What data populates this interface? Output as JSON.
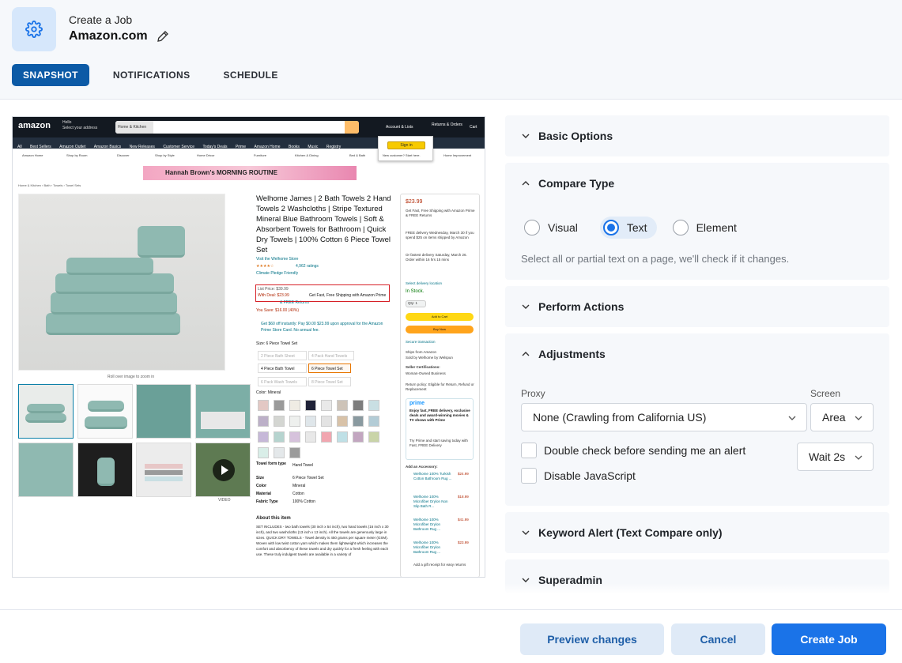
{
  "header": {
    "icon": "gear-icon",
    "subtitle": "Create a Job",
    "title": "Amazon.com",
    "edit_icon": "pencil-icon"
  },
  "tabs": [
    {
      "label": "SNAPSHOT",
      "active": true
    },
    {
      "label": "NOTIFICATIONS",
      "active": false
    },
    {
      "label": "SCHEDULE",
      "active": false
    }
  ],
  "preview": {
    "logo": "amazon",
    "address": "Select your address",
    "search_category": "Home & Kitchen",
    "account": "Account & Lists",
    "returns": "Returns & Orders",
    "cart": "Cart",
    "nav_items": [
      "All",
      "Best Sellers",
      "Amazon Outlet",
      "Amazon Basics",
      "New Releases",
      "Customer Service",
      "Today's Deals",
      "Prime",
      "Amazon Home",
      "Books",
      "Music",
      "Registry"
    ],
    "signin_button": "Sign in",
    "signin_text": "New customer? Start here.",
    "subnav": [
      "Amazon Home",
      "Shop by Room",
      "Discover",
      "Shop by Style",
      "Home Décor",
      "Furniture",
      "Kitchen & Dining",
      "Bed & Bath",
      "Home Improvement"
    ],
    "banner": "Hannah Brown's MORNING ROUTINE",
    "breadcrumb": "Home & Kitchen › Bath › Towels › Towel Sets",
    "roll_over": "Roll over image to zoom in",
    "product_title": "Welhome James | 2 Bath Towels 2 Hand Towels 2 Washcloths | Stripe Textured Mineral Blue Bathroom Towels | Soft & Absorbent Towels for Bathroom | Quick Dry Towels | 100% Cotton 6 Piece Towel Set",
    "store_link": "Visit the Welhome Store",
    "ratings": "4,962 ratings",
    "climate": "Climate Pledge Friendly",
    "list_price": "List Price: $39.99",
    "deal_price": "With Deal: $23.99",
    "free_shipping": "Get Fast, Free Shipping with Amazon Prime",
    "free_returns": "& FREE Returns",
    "you_save": "You Save: $16.00 (40%)",
    "instant_offer": "Get $60 off instantly: Pay $0.00 $23.99 upon approval for the Amazon Prime Store Card. No annual fee.",
    "size_label": "Size: 6 Piece Towel Set",
    "sizes": [
      "2 Piece Bath Sheet",
      "4 Pack Hand Towels",
      "4 Piece Bath Towel",
      "6 Piece Towel Set",
      "6 Pack Wash Towels",
      "8 Piece Towel Set"
    ],
    "color_label": "Color: Mineral",
    "details": [
      [
        "Towel form type",
        "Hand Towel"
      ],
      [
        "Size",
        "6 Piece Towel Set"
      ],
      [
        "Color",
        "Mineral"
      ],
      [
        "Material",
        "Cotton"
      ],
      [
        "Fabric Type",
        "100% Cotton"
      ]
    ],
    "about_title": "About this item",
    "about_text": "SET INCLUDES - two bath towels (30 inch x 54 inch), two hand towels (16 inch x 30 inch), and two washcloths (13 inch x 13 inch). All the towels are generously large in sizes. QUICK DRY TOWELS - Towel density is 450 grams per square meter (GSM). Woven with low twist cotton yarn which makes them lightweight which increases the comfort and absorbency of these towels and dry quickly for a fresh feeling with each use. These truly indulgent towels are available in a variety of",
    "video_label": "VIDEO",
    "buybox": {
      "price": "$23.99",
      "shipping": "Get Fast, Free Shipping with Amazon Prime & FREE Returns",
      "delivery": "FREE delivery Wednesday, March 30 if you spend $25 on items shipped by Amazon",
      "fastest": "Or fastest delivery Saturday, March 26. Order within 16 hrs 15 mins",
      "location": "Select delivery location",
      "stock": "In Stock.",
      "qty": "Qty: 1",
      "add_to_cart": "Add to Cart",
      "buy_now": "Buy Now",
      "secure": "Secure transaction",
      "ships_from": "Ships from  Amazon",
      "sold_by": "Sold by  Welhome by Welspun",
      "cert_title": "Seller Certifications:",
      "cert": "Woman-Owned Business",
      "return_policy": "Return policy: Eligible for Return, Refund or Replacement",
      "prime_logo": "prime",
      "prime_text": "Enjoy fast, FREE delivery, exclusive deals and award-winning movies & TV shows with Prime",
      "prime_try": "Try Prime and start saving today with Fast, FREE Delivery",
      "accessory_title": "Add an Accessory:",
      "accessories": [
        {
          "name": "Welhome 100% Turkish Cotton Bathroom Rug ...",
          "price": "$24.99"
        },
        {
          "name": "Welhome 100% Microfiber Drylon Non Slip Bath R...",
          "price": "$18.99"
        },
        {
          "name": "Welhome 100% Microfiber Drylon Bathroom Rug ...",
          "price": "$41.99"
        },
        {
          "name": "Welhome 100% Microfiber Drylon Bathroom Rug ...",
          "price": "$23.99"
        }
      ],
      "gift": "Add a gift receipt for easy returns"
    }
  },
  "panel": {
    "basic_options": "Basic Options",
    "compare_type": "Compare Type",
    "radios": [
      {
        "label": "Visual",
        "selected": false
      },
      {
        "label": "Text",
        "selected": true
      },
      {
        "label": "Element",
        "selected": false
      }
    ],
    "compare_help": "Select all or partial text on a page, we'll check if it changes.",
    "perform_actions": "Perform Actions",
    "adjustments": "Adjustments",
    "proxy_label": "Proxy",
    "proxy_value": "None (Crawling from California US)",
    "screen_label": "Screen",
    "screen_value": "Area",
    "double_check": "Double check before sending me an alert",
    "wait_value": "Wait 2s",
    "disable_js": "Disable JavaScript",
    "keyword_alert": "Keyword Alert (Text Compare only)",
    "superadmin": "Superadmin"
  },
  "footer": {
    "preview": "Preview changes",
    "cancel": "Cancel",
    "create": "Create Job"
  },
  "colors": {
    "primary": "#1a73e8",
    "tab_active": "#0c5aa6",
    "light_button": "#dfeaf7",
    "panel_bg": "#f6f8fb"
  }
}
